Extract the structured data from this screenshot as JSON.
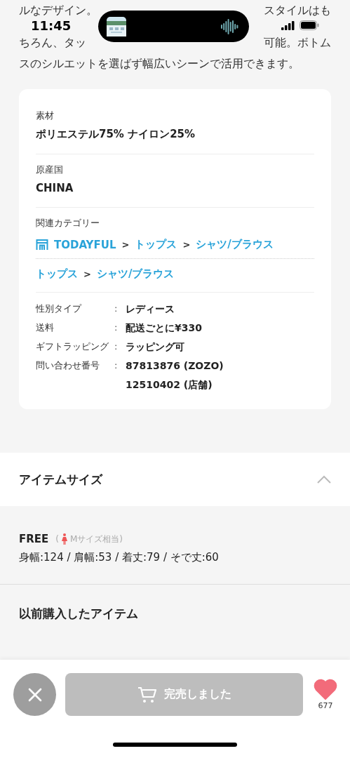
{
  "status_bar": {
    "time": "11:45"
  },
  "description_lines": [
    [
      "ルなデザイン。",
      "スタイルはも"
    ],
    [
      "ちろん、タッ",
      "可能。ボトム"
    ],
    [
      "スのシルエットを選ばず幅広いシーンで活用できます。"
    ]
  ],
  "spec_card": {
    "sections": [
      {
        "label": "素材",
        "value": "ポリエステル75% ナイロン25%"
      },
      {
        "label": "原産国",
        "value": "CHINA"
      }
    ],
    "category": {
      "label": "関連カテゴリー",
      "paths": [
        {
          "kind": "shop",
          "items": [
            {
              "kind": "link",
              "text": "TODAYFUL"
            },
            {
              "kind": "separator",
              "text": ">"
            },
            {
              "kind": "link",
              "text": "トップス"
            },
            {
              "kind": "separator",
              "text": ">"
            },
            {
              "kind": "link",
              "text": "シャツ/ブラウス"
            }
          ]
        },
        {
          "kind": "plain",
          "items": [
            {
              "kind": "link",
              "text": "トップス"
            },
            {
              "kind": "separator",
              "text": ">"
            },
            {
              "kind": "link",
              "text": "シャツ/ブラウス"
            }
          ]
        }
      ]
    },
    "details": [
      {
        "label": "性別タイプ",
        "separator": ":",
        "values": [
          "レディース"
        ]
      },
      {
        "label": "送料",
        "separator": ":",
        "values": [
          "配送ごとに¥330"
        ]
      },
      {
        "label": "ギフトラッピング",
        "separator": ":",
        "values": [
          "ラッピング可"
        ]
      },
      {
        "label": "問い合わせ番号",
        "separator": ":",
        "values": [
          "87813876 (ZOZO)",
          "12510402 (店舗)"
        ]
      }
    ]
  },
  "size_section": {
    "title": "アイテムサイズ",
    "expanded": true,
    "sizes": [
      {
        "name": "FREE",
        "note_open": "(",
        "note": "Mサイズ相当)",
        "measurements": "身幅:124 / 肩幅:53 / 着丈:79 / そで丈:60"
      }
    ]
  },
  "previous_items": {
    "title": "以前購入したアイテム"
  },
  "bottom_bar": {
    "buy_button": {
      "label": "完売しました",
      "disabled": true
    },
    "favorite": {
      "count": "677",
      "favorited": true
    }
  }
}
